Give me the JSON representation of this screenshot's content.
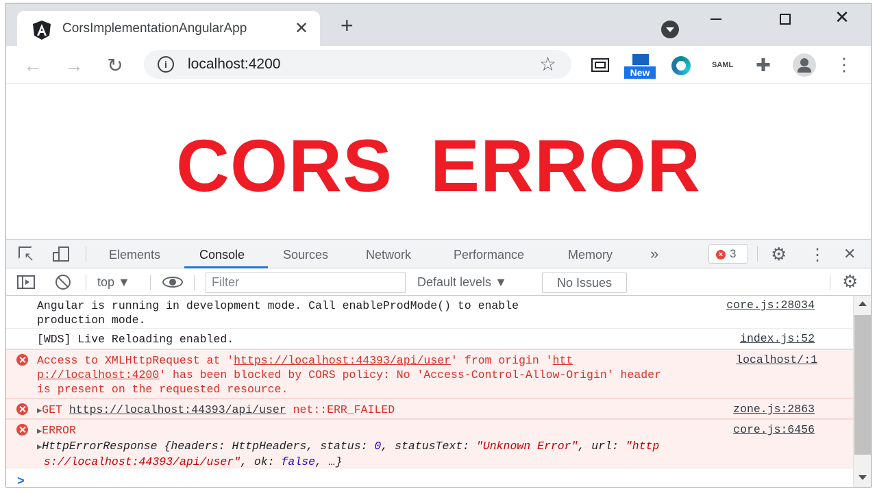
{
  "browser": {
    "tab_title": "CorsImplementationAngularApp",
    "url": "localhost:4200",
    "extensions": [
      "screen-capture-icon",
      "new-badge-extension-icon",
      "edge-like-icon",
      "saml-icon",
      "puzzle-icon"
    ],
    "new_badge": "New",
    "saml_label": "SAML"
  },
  "page": {
    "headline": "CORS ERROR",
    "headline_color": "#ee1c25"
  },
  "devtools": {
    "tabs": [
      "Elements",
      "Console",
      "Sources",
      "Network",
      "Performance",
      "Memory"
    ],
    "active_tab": "Console",
    "more_tabs": "»",
    "error_count": "3",
    "context": "top",
    "filter_placeholder": "Filter",
    "levels": "Default levels",
    "issues": "No Issues"
  },
  "console": {
    "messages": [
      {
        "type": "info",
        "text": "Angular is running in development mode. Call enableProdMode() to enable\nproduction mode.",
        "source": "core.js:28034"
      },
      {
        "type": "info",
        "text": "[WDS] Live Reloading enabled.",
        "source": "index.js:52"
      },
      {
        "type": "error",
        "text_pre": "Access to XMLHttpRequest at '",
        "text_link": "https://localhost:44393/api/user",
        "text_mid": "' from origin '",
        "text_link2": "htt",
        "line2_link": "p://localhost:4200",
        "line2": "' has been blocked by CORS policy: No 'Access-Control-Allow-Origin' header",
        "line3": "is present on the requested resource.",
        "source": "localhost/:1"
      },
      {
        "type": "error",
        "method": "GET",
        "url": "https://localhost:44393/api/user",
        "status": "net::ERR_FAILED",
        "source": "zone.js:2863"
      },
      {
        "type": "error",
        "label": "ERROR",
        "obj_name": "HttpErrorResponse",
        "obj_p1": " {headers: HttpHeaders, status: ",
        "obj_status": "0",
        "obj_p2": ", statusText: ",
        "obj_statusText": "\"Unknown Error\"",
        "obj_p3": ", url: ",
        "obj_url1": "\"http",
        "obj_url2": "s://localhost:44393/api/user\"",
        "obj_p4": ", ok: ",
        "obj_ok": "false",
        "obj_p5": ", …}",
        "source": "core.js:6456"
      }
    ],
    "prompt": ">"
  }
}
